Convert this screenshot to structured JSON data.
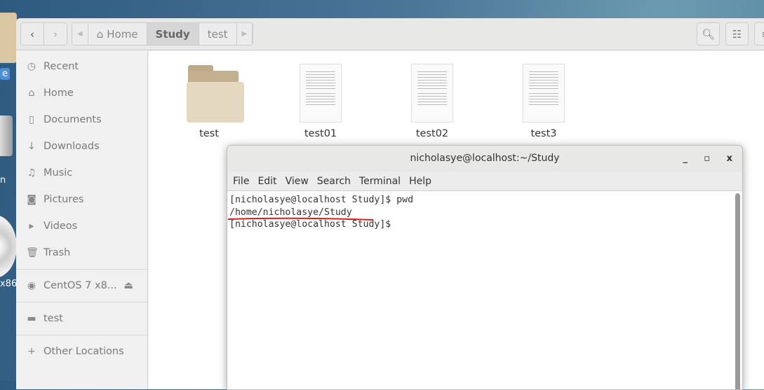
{
  "desktop": {
    "labels": [
      "e",
      "n",
      "x86."
    ]
  },
  "file_manager": {
    "nav": {
      "back": "‹",
      "forward": "›"
    },
    "breadcrumbs": [
      {
        "label": "Home",
        "icon": "home-icon"
      },
      {
        "label": "Study",
        "current": true
      },
      {
        "label": "test"
      }
    ],
    "sidebar": [
      {
        "label": "Recent",
        "icon": "clock-icon"
      },
      {
        "label": "Home",
        "icon": "home-icon"
      },
      {
        "label": "Documents",
        "icon": "document-icon"
      },
      {
        "label": "Downloads",
        "icon": "download-icon"
      },
      {
        "label": "Music",
        "icon": "music-icon"
      },
      {
        "label": "Pictures",
        "icon": "camera-icon"
      },
      {
        "label": "Videos",
        "icon": "video-icon"
      },
      {
        "label": "Trash",
        "icon": "trash-icon"
      },
      {
        "label": "CentOS 7 x8...",
        "icon": "disc-icon"
      },
      {
        "label": "test",
        "icon": "folder-icon"
      },
      {
        "label": "Other Locations",
        "icon": "plus-icon"
      }
    ],
    "files": [
      {
        "name": "test",
        "type": "folder"
      },
      {
        "name": "test01",
        "type": "text"
      },
      {
        "name": "test02",
        "type": "text"
      },
      {
        "name": "test3",
        "type": "text"
      }
    ]
  },
  "terminal": {
    "title": "nicholasye@localhost:~/Study",
    "menu": [
      "File",
      "Edit",
      "View",
      "Search",
      "Terminal",
      "Help"
    ],
    "lines": [
      "[nicholasye@localhost Study]$ pwd",
      "/home/nicholasye/Study",
      "[nicholasye@localhost Study]$"
    ],
    "annotation_color": "#d32020"
  }
}
